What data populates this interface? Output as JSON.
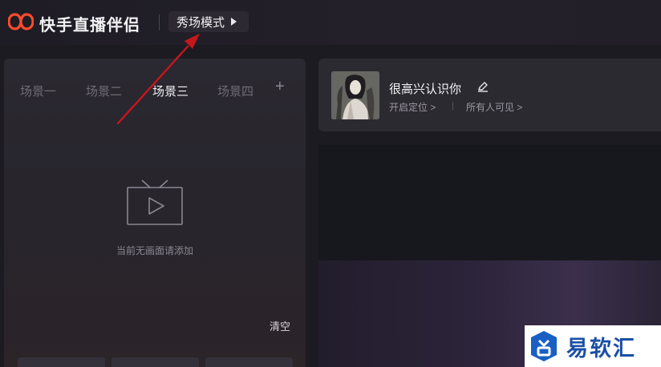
{
  "app": {
    "title": "快手直播伴侣",
    "mode_label": "秀场模式",
    "brand_color": "#ff4b2b"
  },
  "scenes": {
    "tabs": [
      {
        "label": "场景一",
        "active": false
      },
      {
        "label": "场景二",
        "active": false
      },
      {
        "label": "场景三",
        "active": true
      },
      {
        "label": "场景四",
        "active": false
      }
    ],
    "add_label": "+",
    "empty_text": "当前无画面请添加",
    "clear_label": "清空"
  },
  "profile": {
    "name": "很高兴认识你",
    "location_link": "开启定位 >",
    "separator": "|",
    "visibility_link": "所有人可见 >"
  },
  "watermark": {
    "text": "易软汇"
  },
  "icons": {
    "logo": "kuaishou-logo-icon",
    "mode_arrow": "play-triangle-icon",
    "tv": "tv-play-icon",
    "edit": "pencil-edit-icon"
  },
  "annotation": {
    "color": "#c8161d"
  }
}
